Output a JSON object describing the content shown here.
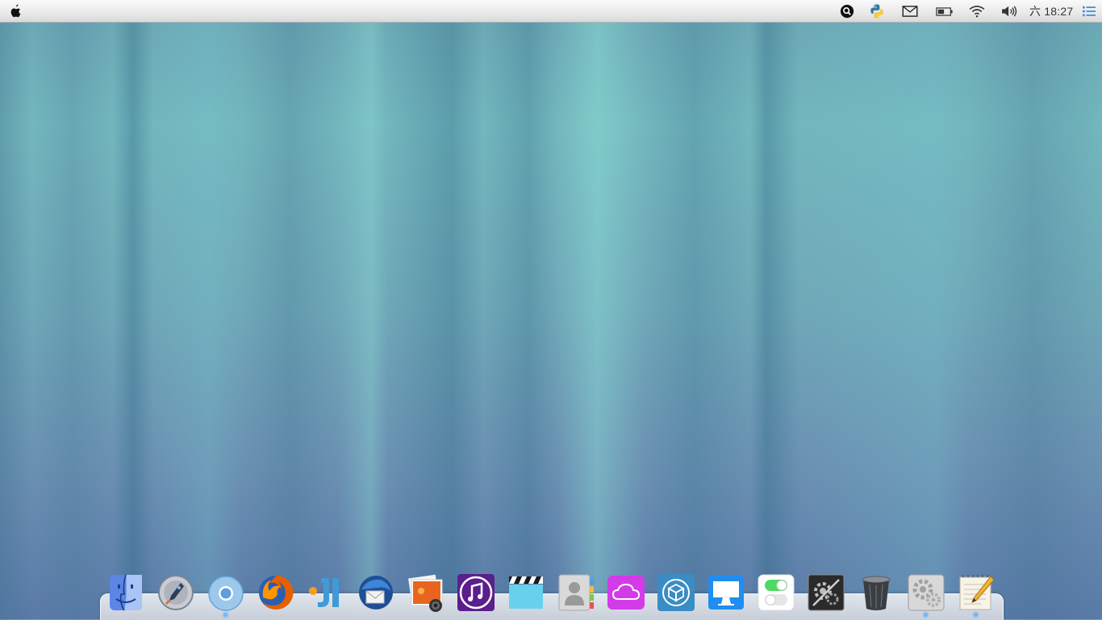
{
  "menubar": {
    "clock": "六 18:27",
    "tray_icons": [
      "search-icon",
      "python-icon",
      "mail-icon",
      "battery-icon",
      "wifi-icon",
      "volume-icon",
      "menu-list-icon"
    ]
  },
  "dock": {
    "items": [
      {
        "name": "finder-icon",
        "running": false
      },
      {
        "name": "launchpad-icon",
        "running": false
      },
      {
        "name": "chrome-icon",
        "running": true
      },
      {
        "name": "firefox-icon",
        "running": false
      },
      {
        "name": "jetbrains-icon",
        "running": false
      },
      {
        "name": "thunderbird-icon",
        "running": false
      },
      {
        "name": "photos-icon",
        "running": false
      },
      {
        "name": "itunes-icon",
        "running": false
      },
      {
        "name": "video-clapper-icon",
        "running": false
      },
      {
        "name": "contacts-icon",
        "running": false
      },
      {
        "name": "icloud-icon",
        "running": false
      },
      {
        "name": "cydia-package-icon",
        "running": false
      },
      {
        "name": "display-icon",
        "running": false
      },
      {
        "name": "toggle-settings-icon",
        "running": false
      },
      {
        "name": "system-utility-icon",
        "running": false
      },
      {
        "name": "trash-icon",
        "running": false
      },
      {
        "name": "system-preferences-icon",
        "running": true
      },
      {
        "name": "text-editor-icon",
        "running": true
      }
    ]
  },
  "colors": {
    "accent": "#6fb8f0",
    "menubar_bg": "#ececec"
  }
}
